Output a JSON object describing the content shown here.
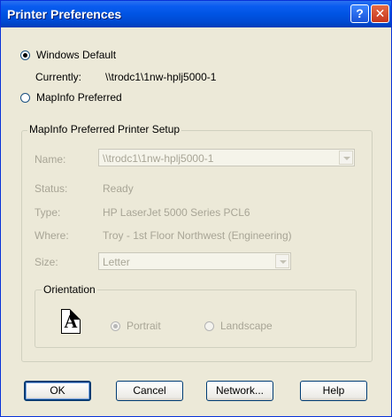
{
  "window": {
    "title": "Printer Preferences",
    "help_glyph": "?",
    "close_glyph": "✕"
  },
  "source": {
    "windows_default_label": "Windows Default",
    "windows_default_checked": true,
    "currently_label": "Currently:",
    "currently_value": "\\\\trodc1\\1nw-hplj5000-1",
    "mapinfo_preferred_label": "MapInfo Preferred",
    "mapinfo_preferred_checked": false
  },
  "setup": {
    "group_title": "MapInfo Preferred Printer Setup",
    "name_label": "Name:",
    "name_value": "\\\\trodc1\\1nw-hplj5000-1",
    "status_label": "Status:",
    "status_value": "Ready",
    "type_label": "Type:",
    "type_value": "HP LaserJet 5000 Series PCL6",
    "where_label": "Where:",
    "where_value": "Troy - 1st Floor Northwest (Engineering)",
    "size_label": "Size:",
    "size_value": "Letter"
  },
  "orientation": {
    "group_title": "Orientation",
    "icon_letter": "A",
    "portrait_label": "Portrait",
    "landscape_label": "Landscape",
    "selected": "Portrait"
  },
  "buttons": {
    "ok": "OK",
    "cancel": "Cancel",
    "network": "Network...",
    "help": "Help"
  }
}
